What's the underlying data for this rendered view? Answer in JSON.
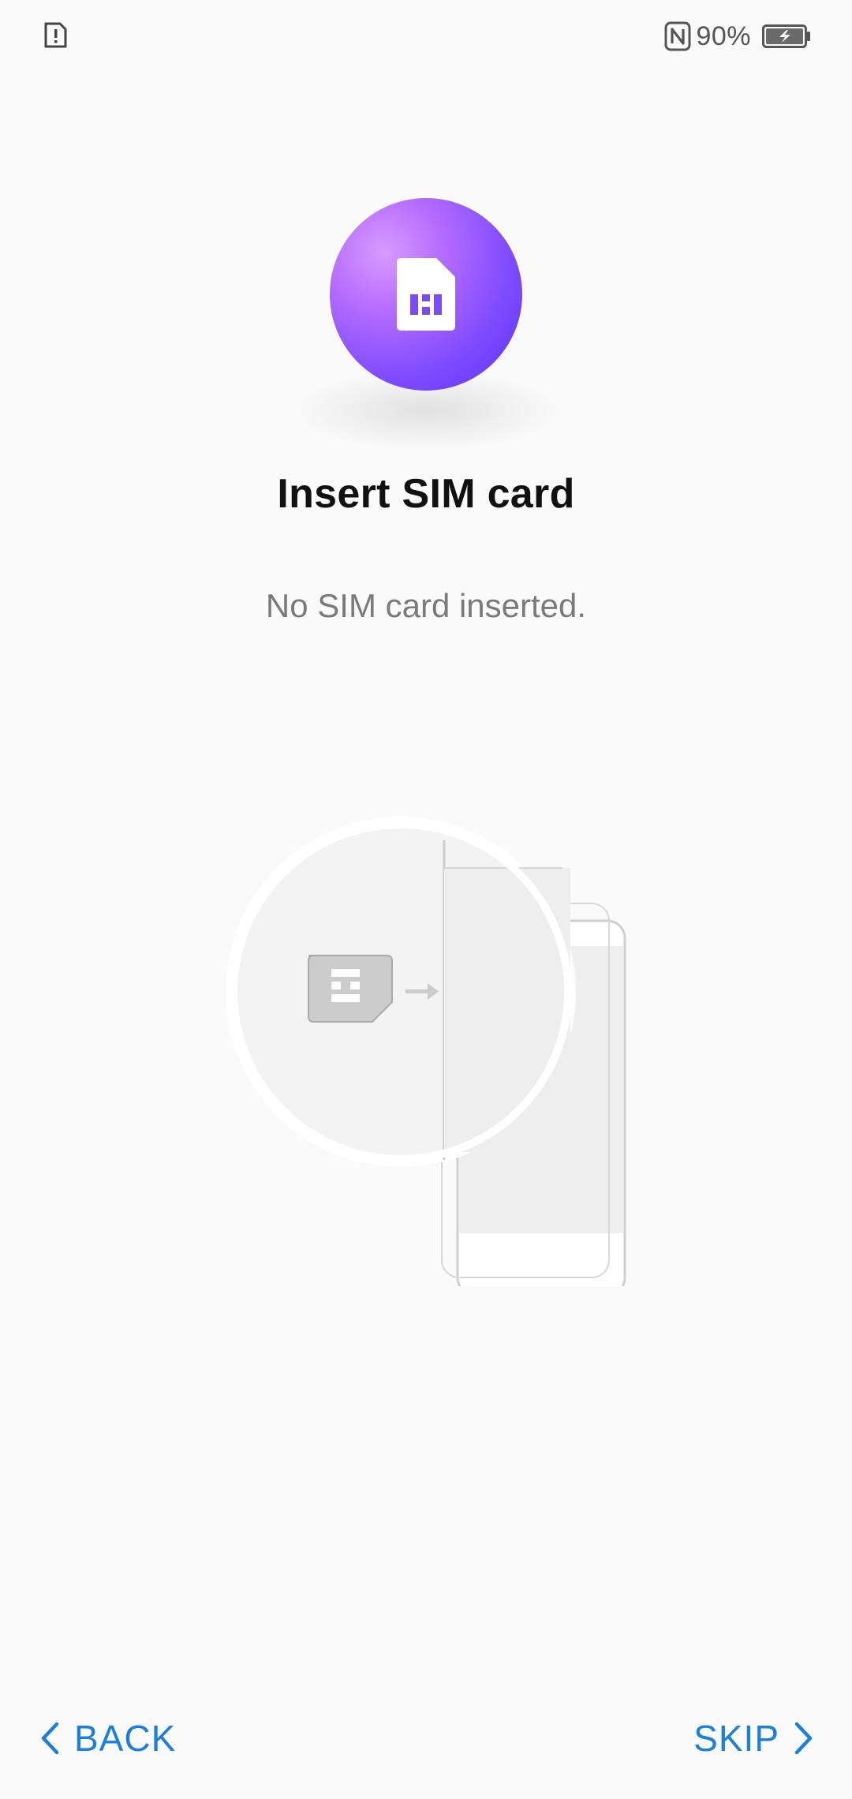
{
  "status_bar": {
    "left_icon": "sim-alert-icon",
    "nfc_icon": "nfc-icon",
    "battery_percent": "90%",
    "battery_icon": "battery-charging-icon"
  },
  "hero": {
    "icon": "sim-card-icon",
    "gradient_colors": [
      "#d79bff",
      "#7f4bff",
      "#5a33f6"
    ]
  },
  "title": "Insert SIM card",
  "subtitle": "No SIM card inserted.",
  "illustration": {
    "sim_icon": "sim-card-icon",
    "arrow_icon": "arrow-right-icon",
    "phone_icon": "phone-icon"
  },
  "nav": {
    "back_label": "BACK",
    "skip_label": "SKIP",
    "accent_color": "#1a7fe0"
  }
}
